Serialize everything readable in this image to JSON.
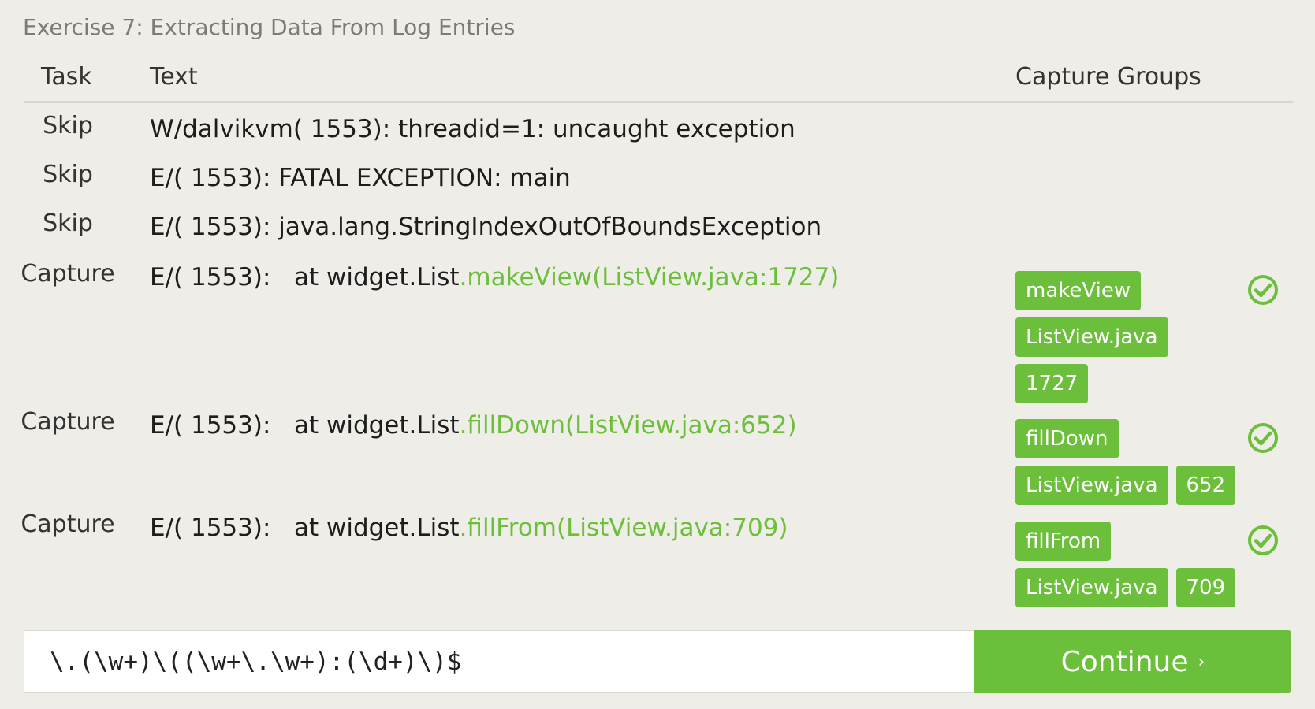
{
  "title": "Exercise 7: Extracting Data From Log Entries",
  "headers": {
    "task": "Task",
    "text": "Text",
    "capture_groups": "Capture Groups"
  },
  "rows": [
    {
      "task": "Skip",
      "prefix": "W/dalvikvm( 1553): threadid=1: uncaught exception",
      "match": "",
      "groups": [],
      "status": ""
    },
    {
      "task": "Skip",
      "prefix": "E/( 1553): FATAL EXCEPTION: main",
      "match": "",
      "groups": [],
      "status": ""
    },
    {
      "task": "Skip",
      "prefix": "E/( 1553): java.lang.StringIndexOutOfBoundsException",
      "match": "",
      "groups": [],
      "status": ""
    },
    {
      "task": "Capture",
      "prefix": "E/( 1553):   at widget.List",
      "match": ".makeView(ListView.java:1727)",
      "groups": [
        "makeView",
        "ListView.java",
        "1727"
      ],
      "status": "check-circle-icon"
    },
    {
      "task": "Capture",
      "prefix": "E/( 1553):   at widget.List",
      "match": ".fillDown(ListView.java:652)",
      "groups": [
        "fillDown",
        "ListView.java",
        "652"
      ],
      "status": "check-circle-icon"
    },
    {
      "task": "Capture",
      "prefix": "E/( 1553):   at widget.List",
      "match": ".fillFrom(ListView.java:709)",
      "groups": [
        "fillFrom",
        "ListView.java",
        "709"
      ],
      "status": "check-circle-icon"
    }
  ],
  "regex_input": {
    "value": "\\.(\\w+)\\((\\w+\\.\\w+):(\\d+)\\)$"
  },
  "continue_button": {
    "label": "Continue",
    "arrow": "›"
  },
  "colors": {
    "accent": "#6bbf3a",
    "background": "#efede8"
  }
}
